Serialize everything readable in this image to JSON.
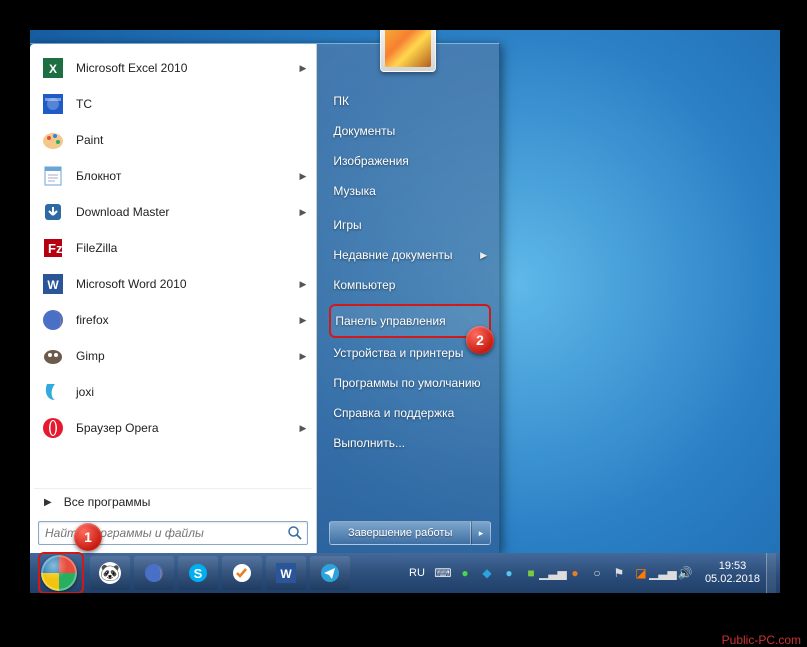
{
  "colors": {
    "highlight": "#d01a1a",
    "desktop_gradient_inner": "#5fb8e8",
    "desktop_gradient_outer": "#145a9e"
  },
  "callouts": {
    "one": "1",
    "two": "2"
  },
  "start_menu": {
    "programs": [
      {
        "label": "Microsoft Excel 2010",
        "icon": "excel-icon",
        "has_submenu": true
      },
      {
        "label": "TC",
        "icon": "tc-icon",
        "has_submenu": false
      },
      {
        "label": "Paint",
        "icon": "paint-icon",
        "has_submenu": false
      },
      {
        "label": "Блокнот",
        "icon": "notepad-icon",
        "has_submenu": true
      },
      {
        "label": "Download Master",
        "icon": "download-master-icon",
        "has_submenu": true
      },
      {
        "label": "FileZilla",
        "icon": "filezilla-icon",
        "has_submenu": false
      },
      {
        "label": "Microsoft Word 2010",
        "icon": "word-icon",
        "has_submenu": true
      },
      {
        "label": "firefox",
        "icon": "firefox-icon",
        "has_submenu": true
      },
      {
        "label": "Gimp",
        "icon": "gimp-icon",
        "has_submenu": true
      },
      {
        "label": "joxi",
        "icon": "joxi-icon",
        "has_submenu": false
      },
      {
        "label": "Браузер Opera",
        "icon": "opera-icon",
        "has_submenu": true
      }
    ],
    "all_programs": "Все программы",
    "search_placeholder": "Найти программы и файлы"
  },
  "right_panel": {
    "items": [
      {
        "label": "ПК",
        "submenu": false
      },
      {
        "label": "Документы",
        "submenu": false
      },
      {
        "label": "Изображения",
        "submenu": false
      },
      {
        "label": "Музыка",
        "submenu": false
      },
      {
        "label": "Игры",
        "submenu": false
      },
      {
        "label": "Недавние документы",
        "submenu": true
      },
      {
        "label": "Компьютер",
        "submenu": false
      },
      {
        "label": "Панель управления",
        "submenu": false,
        "highlighted": true
      },
      {
        "label": "Устройства и принтеры",
        "submenu": false
      },
      {
        "label": "Программы по умолчанию",
        "submenu": false
      },
      {
        "label": "Справка и поддержка",
        "submenu": false
      },
      {
        "label": "Выполнить...",
        "submenu": false
      }
    ],
    "shutdown": "Завершение работы"
  },
  "taskbar": {
    "pinned": [
      {
        "name": "panda",
        "glyph": "🐼"
      },
      {
        "name": "firefox",
        "glyph": "🦊"
      },
      {
        "name": "skype",
        "glyph": "S"
      },
      {
        "name": "checkmark",
        "glyph": "✔"
      },
      {
        "name": "word",
        "glyph": "W"
      },
      {
        "name": "telegram",
        "glyph": "✈"
      }
    ],
    "language": "RU",
    "keyboard_icon": "⌨",
    "time": "19:53",
    "date": "05.02.2018"
  },
  "watermark": "Public-PC.com"
}
